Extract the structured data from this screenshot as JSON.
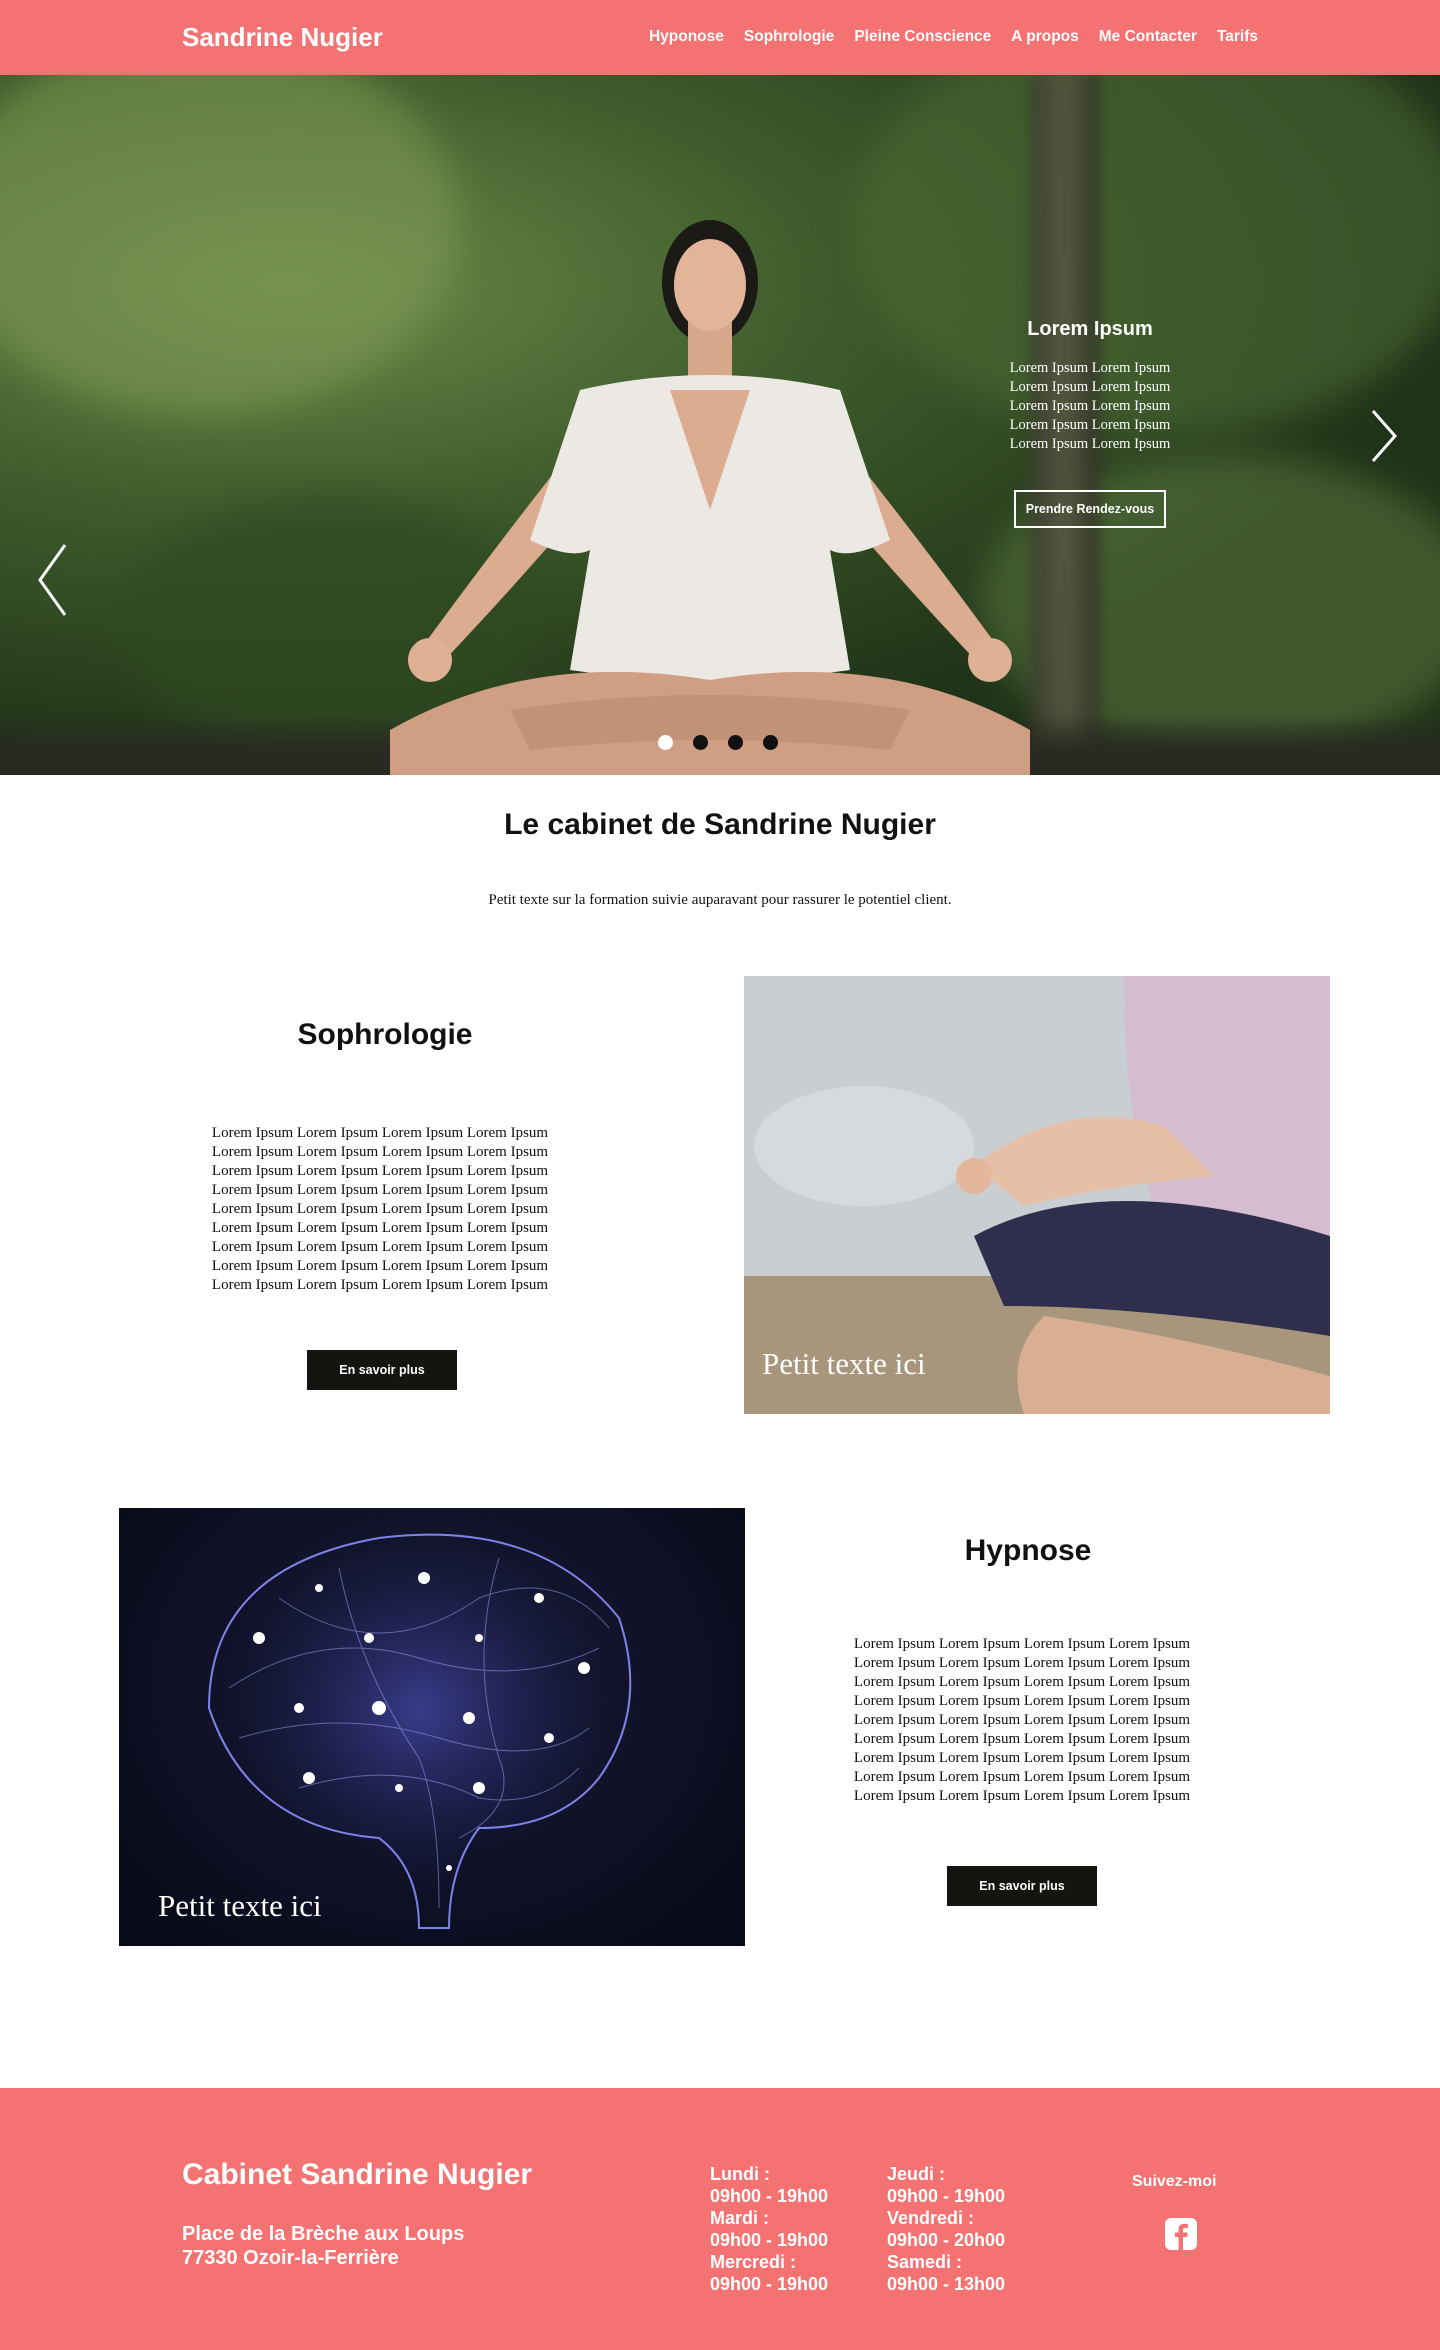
{
  "header": {
    "brand": "Sandrine Nugier",
    "nav": [
      "Hyponose",
      "Sophrologie",
      "Pleine Conscience",
      "A propos",
      "Me Contacter",
      "Tarifs"
    ]
  },
  "hero": {
    "title": "Lorem Ipsum",
    "lines": [
      "Lorem Ipsum Lorem Ipsum",
      "Lorem Ipsum Lorem Ipsum",
      "Lorem Ipsum Lorem Ipsum",
      "Lorem Ipsum Lorem Ipsum",
      "Lorem Ipsum Lorem Ipsum"
    ],
    "button": "Prendre Rendez-vous",
    "slides": 4,
    "active_slide": 1
  },
  "intro": {
    "title": "Le cabinet de Sandrine Nugier",
    "text": "Petit texte sur la formation suivie auparavant pour rassurer le potentiel client."
  },
  "sophrologie": {
    "title": "Sophrologie",
    "lines": [
      "Lorem Ipsum Lorem Ipsum Lorem Ipsum Lorem Ipsum",
      "Lorem Ipsum Lorem Ipsum Lorem Ipsum Lorem Ipsum",
      "Lorem Ipsum Lorem Ipsum Lorem Ipsum Lorem Ipsum",
      "Lorem Ipsum Lorem Ipsum Lorem Ipsum Lorem Ipsum",
      "Lorem Ipsum Lorem Ipsum Lorem Ipsum Lorem Ipsum",
      "Lorem Ipsum Lorem Ipsum Lorem Ipsum Lorem Ipsum",
      "Lorem Ipsum Lorem Ipsum Lorem Ipsum Lorem Ipsum",
      "Lorem Ipsum Lorem Ipsum Lorem Ipsum Lorem Ipsum",
      "Lorem Ipsum Lorem Ipsum Lorem Ipsum Lorem Ipsum"
    ],
    "button": "En savoir plus",
    "caption": "Petit texte ici"
  },
  "hypnose": {
    "title": "Hypnose",
    "lines": [
      "Lorem Ipsum Lorem Ipsum Lorem Ipsum Lorem Ipsum",
      "Lorem Ipsum Lorem Ipsum Lorem Ipsum Lorem Ipsum",
      "Lorem Ipsum Lorem Ipsum Lorem Ipsum Lorem Ipsum",
      "Lorem Ipsum Lorem Ipsum Lorem Ipsum Lorem Ipsum",
      "Lorem Ipsum Lorem Ipsum Lorem Ipsum Lorem Ipsum",
      "Lorem Ipsum Lorem Ipsum Lorem Ipsum Lorem Ipsum",
      "Lorem Ipsum Lorem Ipsum Lorem Ipsum Lorem Ipsum",
      "Lorem Ipsum Lorem Ipsum Lorem Ipsum Lorem Ipsum",
      "Lorem Ipsum Lorem Ipsum Lorem Ipsum Lorem Ipsum"
    ],
    "button": "En savoir plus",
    "caption": "Petit texte ici"
  },
  "footer": {
    "title": "Cabinet Sandrine Nugier",
    "address_line1": "Place de la Brèche aux Loups",
    "address_line2": "77330 Ozoir-la-Ferrière",
    "hours_col1": [
      {
        "day": "Lundi :",
        "time": "09h00 - 19h00"
      },
      {
        "day": "Mardi :",
        "time": "09h00 - 19h00"
      },
      {
        "day": "Mercredi :",
        "time": "09h00 - 19h00"
      }
    ],
    "hours_col2": [
      {
        "day": "Jeudi :",
        "time": "09h00 - 19h00"
      },
      {
        "day": "Vendredi :",
        "time": "09h00 - 20h00"
      },
      {
        "day": "Samedi :",
        "time": "09h00 - 13h00"
      }
    ],
    "follow": "Suivez-moi",
    "social_icon": "facebook-icon"
  },
  "colors": {
    "accent": "#f47272",
    "button_dark": "#141510",
    "text": "#111111"
  }
}
